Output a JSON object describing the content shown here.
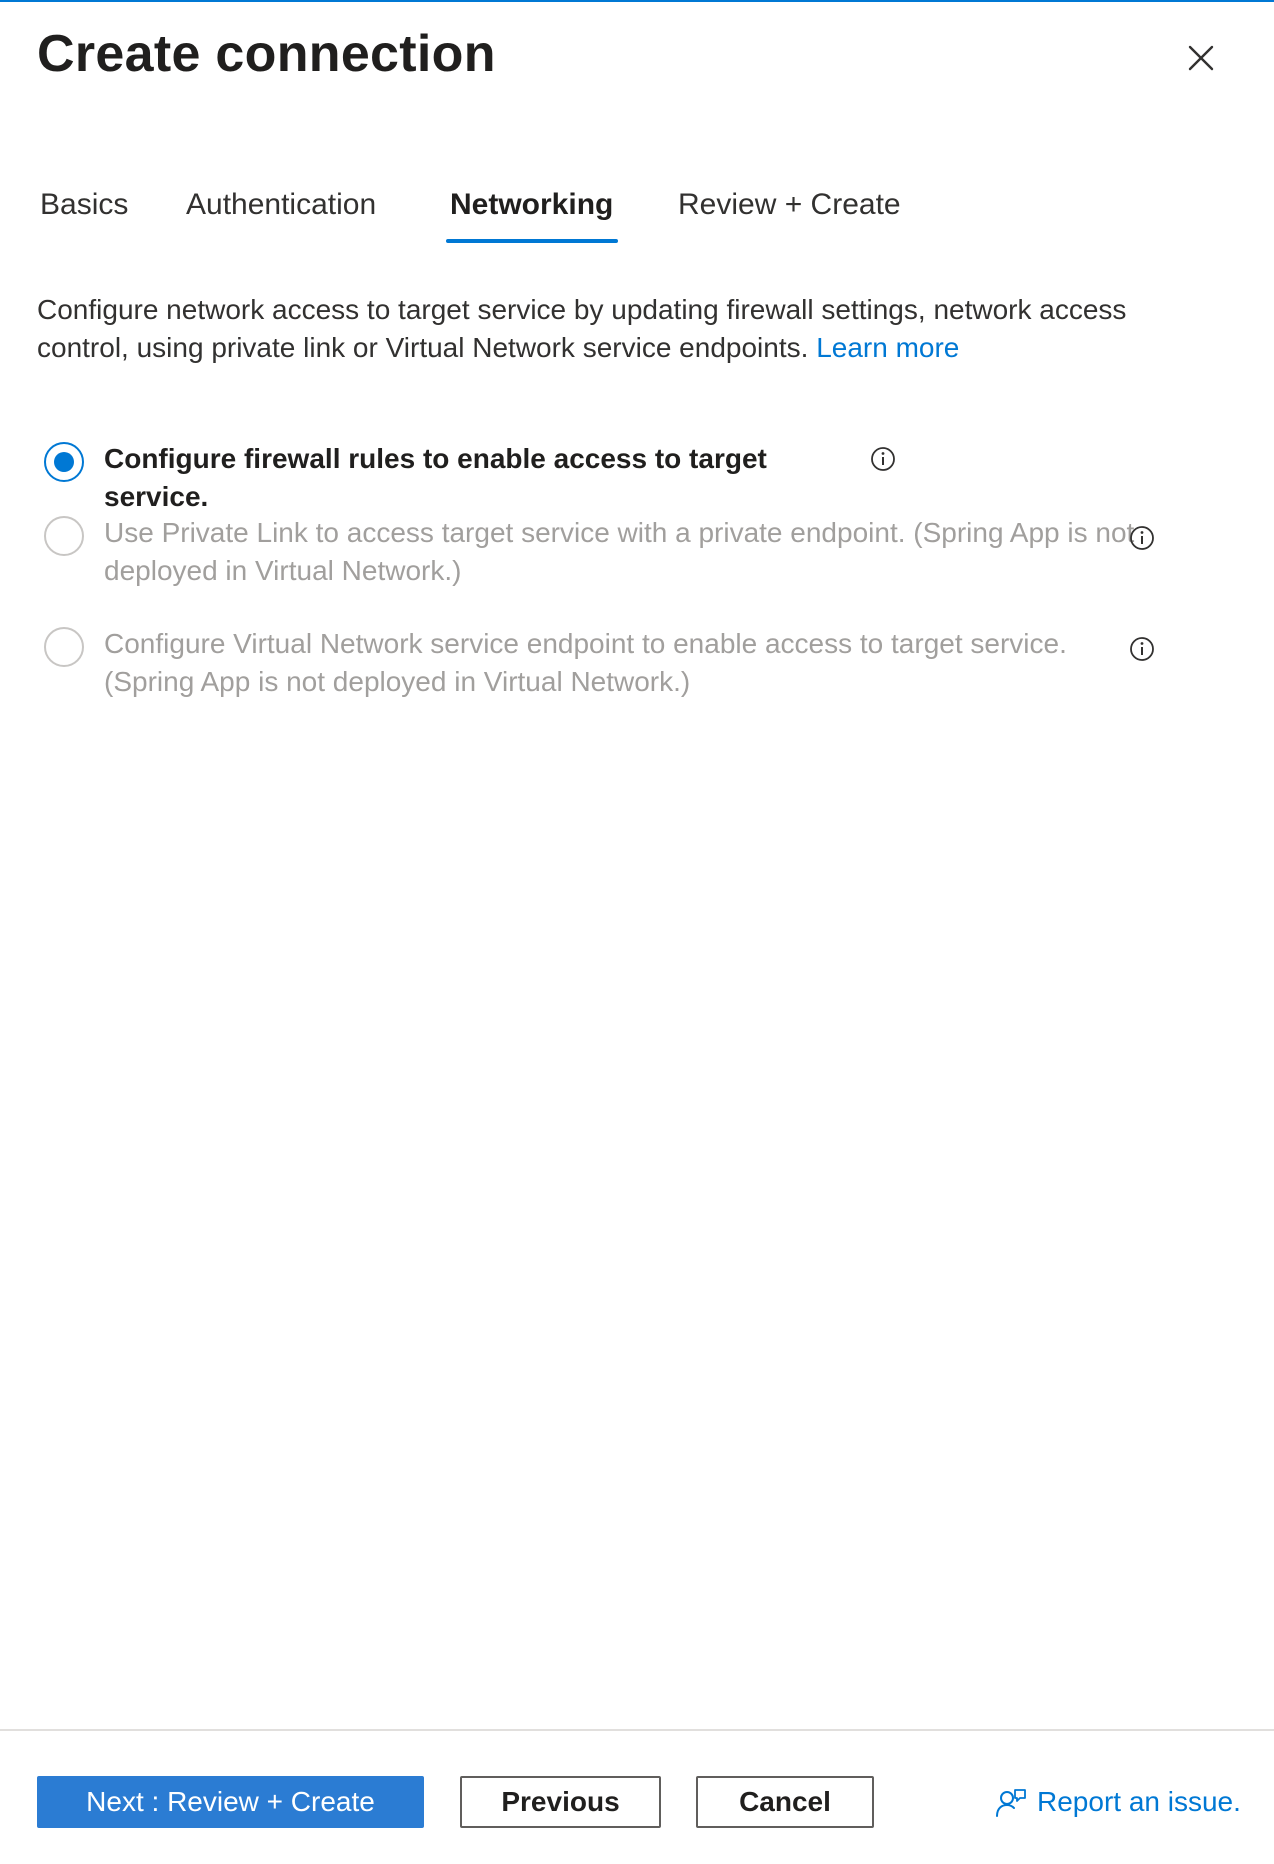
{
  "dialog": {
    "title": "Create connection"
  },
  "tabs": [
    {
      "label": "Basics",
      "active": false
    },
    {
      "label": "Authentication",
      "active": false
    },
    {
      "label": "Networking",
      "active": true
    },
    {
      "label": "Review + Create",
      "active": false
    }
  ],
  "description": {
    "text": "Configure network access to target service by updating firewall settings, network access control, using private link or Virtual Network service endpoints.",
    "link_label": "Learn more"
  },
  "options": [
    {
      "label": "Configure firewall rules to enable access to target service.",
      "selected": true,
      "enabled": true
    },
    {
      "label": "Use Private Link to access target service with a private endpoint. (Spring App is not deployed in Virtual Network.)",
      "selected": false,
      "enabled": false
    },
    {
      "label": "Configure Virtual Network service endpoint to enable access to target service. (Spring App is not deployed in Virtual Network.)",
      "selected": false,
      "enabled": false
    }
  ],
  "footer": {
    "next_label": "Next : Review + Create",
    "previous_label": "Previous",
    "cancel_label": "Cancel",
    "report_label": "Report an issue."
  },
  "colors": {
    "accent": "#0078d4",
    "primary_button": "#2b7cd3",
    "disabled_text": "#a19f9d"
  },
  "icons": [
    "close-icon",
    "info-icon",
    "feedback-person-icon"
  ]
}
